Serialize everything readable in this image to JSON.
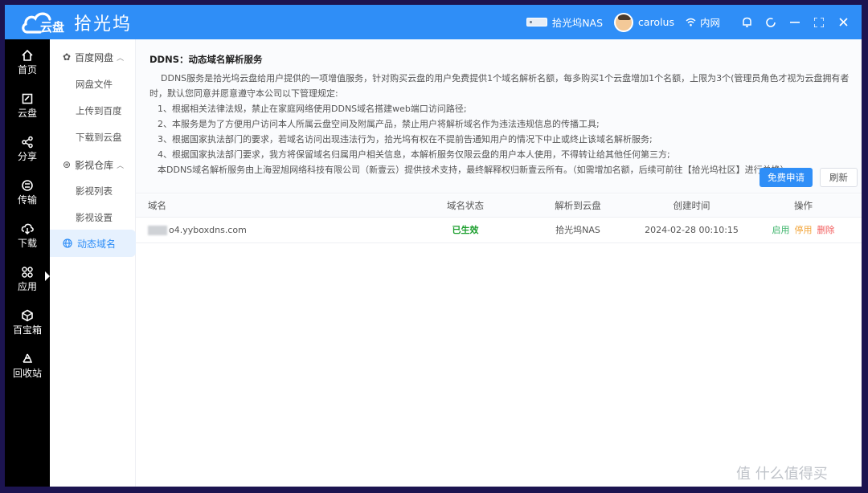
{
  "app": {
    "title": "拾光坞",
    "logo_text": "云盘"
  },
  "header": {
    "device_name": "拾光坞NAS",
    "username": "carolus",
    "network": "内网",
    "icons": [
      "bell-icon",
      "refresh-icon",
      "minimize-icon",
      "fullscreen-icon",
      "close-icon"
    ]
  },
  "nav": {
    "items": [
      {
        "label": "首页",
        "icon": "home-icon"
      },
      {
        "label": "云盘",
        "icon": "drive-icon"
      },
      {
        "label": "分享",
        "icon": "share-icon"
      },
      {
        "label": "传输",
        "icon": "transfer-icon"
      },
      {
        "label": "下载",
        "icon": "download-icon"
      },
      {
        "label": "应用",
        "icon": "apps-icon",
        "active": true
      },
      {
        "label": "百宝箱",
        "icon": "toolbox-icon"
      },
      {
        "label": "回收站",
        "icon": "recycle-icon"
      }
    ]
  },
  "submenu": {
    "group1": {
      "label": "百度网盘",
      "items": [
        "网盘文件",
        "上传到百度",
        "下载到云盘"
      ]
    },
    "group2": {
      "label": "影视仓库",
      "items": [
        "影视列表",
        "影视设置"
      ]
    },
    "active": "动态域名"
  },
  "notice": {
    "title": "DDNS：动态域名解析服务",
    "lines": [
      "DDNS服务是拾光坞云盘给用户提供的一项增值服务，针对购买云盘的用户免费提供1个域名解析名额，每多购买1个云盘增加1个名额，上限为3个(管理员角色才视为云盘拥有者)，当您使用本服务",
      "时，默认您同意并愿意遵守本公司以下管理规定:",
      "1、根据相关法律法规，禁止在家庭网络使用DDNS域名搭建web端口访问路径;",
      "2、本服务是为了方便用户访问本人所属云盘空间及附属产品，禁止用户将解析域名作为违法违规信息的传播工具;",
      "3、根据国家执法部门的要求，若域名访问出现违法行为，拾光坞有权在不提前告通知用户的情况下中止或终止该域名解析服务;",
      "4、根据国家执法部门要求，我方将保留域名归属用户相关信息，本解析服务仅限云盘的用户本人使用，不得转让给其他任何第三方;",
      "本DDNS域名解析服务由上海翌旭网络科技有限公司（新壹云）提供技术支持，最终解释权归新壹云所有。（如需增加名额，后续可前往【拾光坞社区】进行兑换）"
    ],
    "apply_label": "免费申请",
    "refresh_label": "刷新"
  },
  "table": {
    "columns": [
      "域名",
      "域名状态",
      "解析到云盘",
      "创建时间",
      "操作"
    ],
    "rows": [
      {
        "domain": "o4.yyboxdns.com",
        "status": "已生效",
        "device": "拾光坞NAS",
        "created": "2024-02-28 00:10:15",
        "actions": {
          "enable": "启用",
          "disable": "停用",
          "delete": "删除"
        }
      }
    ]
  },
  "watermark": "值 什么值得买"
}
